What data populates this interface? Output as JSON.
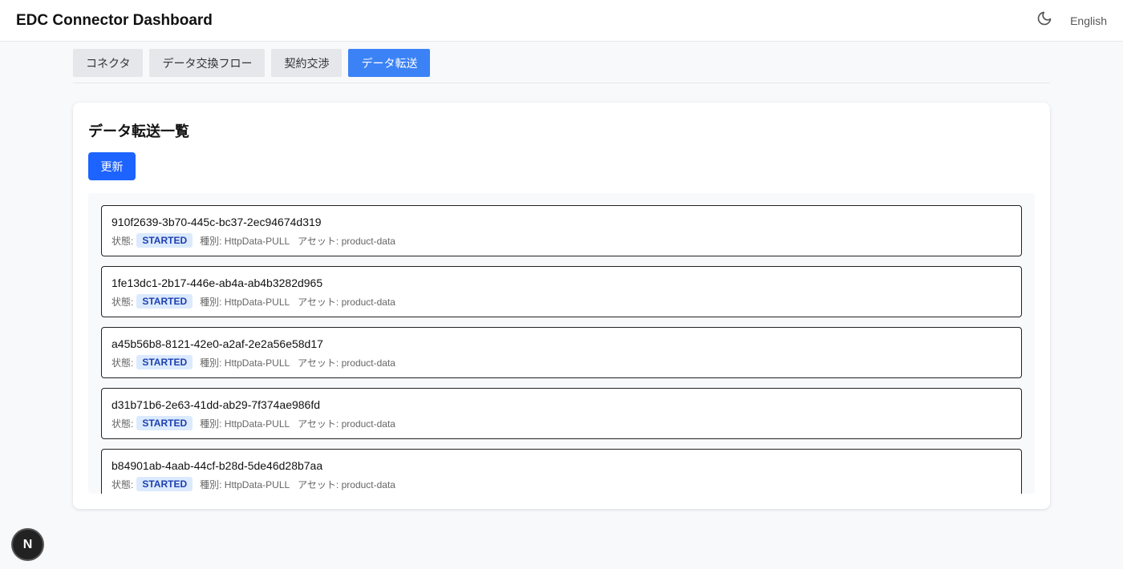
{
  "header": {
    "title": "EDC Connector Dashboard",
    "language": "English"
  },
  "tabs": [
    {
      "label": "コネクタ"
    },
    {
      "label": "データ交換フロー"
    },
    {
      "label": "契約交渉"
    },
    {
      "label": "データ転送"
    }
  ],
  "panel": {
    "title": "データ転送一覧",
    "refresh_label": "更新"
  },
  "transfers": [
    {
      "id": "910f2639-3b70-445c-bc37-2ec94674d319",
      "state_label": "状態:",
      "state": "STARTED",
      "type": "種別: HttpData-PULL",
      "asset": "アセット: product-data"
    },
    {
      "id": "1fe13dc1-2b17-446e-ab4a-ab4b3282d965",
      "state_label": "状態:",
      "state": "STARTED",
      "type": "種別: HttpData-PULL",
      "asset": "アセット: product-data"
    },
    {
      "id": "a45b56b8-8121-42e0-a2af-2e2a56e58d17",
      "state_label": "状態:",
      "state": "STARTED",
      "type": "種別: HttpData-PULL",
      "asset": "アセット: product-data"
    },
    {
      "id": "d31b71b6-2e63-41dd-ab29-7f374ae986fd",
      "state_label": "状態:",
      "state": "STARTED",
      "type": "種別: HttpData-PULL",
      "asset": "アセット: product-data"
    },
    {
      "id": "b84901ab-4aab-44cf-b28d-5de46d28b7aa",
      "state_label": "状態:",
      "state": "STARTED",
      "type": "種別: HttpData-PULL",
      "asset": "アセット: product-data"
    }
  ],
  "dev_badge": "N"
}
